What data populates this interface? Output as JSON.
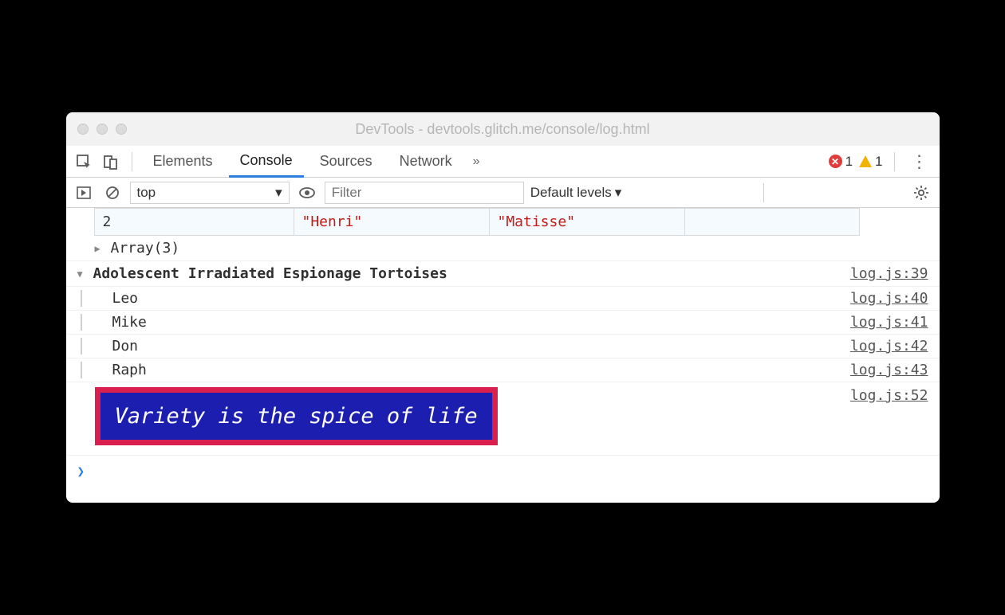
{
  "window": {
    "title": "DevTools - devtools.glitch.me/console/log.html"
  },
  "tabs": {
    "elements": "Elements",
    "console": "Console",
    "sources": "Sources",
    "network": "Network"
  },
  "status": {
    "errors": "1",
    "warnings": "1"
  },
  "toolbar": {
    "context": "top",
    "filter_placeholder": "Filter",
    "levels": "Default levels"
  },
  "table_row": {
    "index": "2",
    "first": "\"Henri\"",
    "last": "\"Matisse\""
  },
  "array_collapsed": "Array(3)",
  "group": {
    "title": "Adolescent Irradiated Espionage Tortoises",
    "src": "log.js:39",
    "items": [
      {
        "text": "Leo",
        "src": "log.js:40"
      },
      {
        "text": "Mike",
        "src": "log.js:41"
      },
      {
        "text": "Don",
        "src": "log.js:42"
      },
      {
        "text": "Raph",
        "src": "log.js:43"
      }
    ]
  },
  "styled": {
    "text": "Variety is the spice of life",
    "src": "log.js:52"
  }
}
